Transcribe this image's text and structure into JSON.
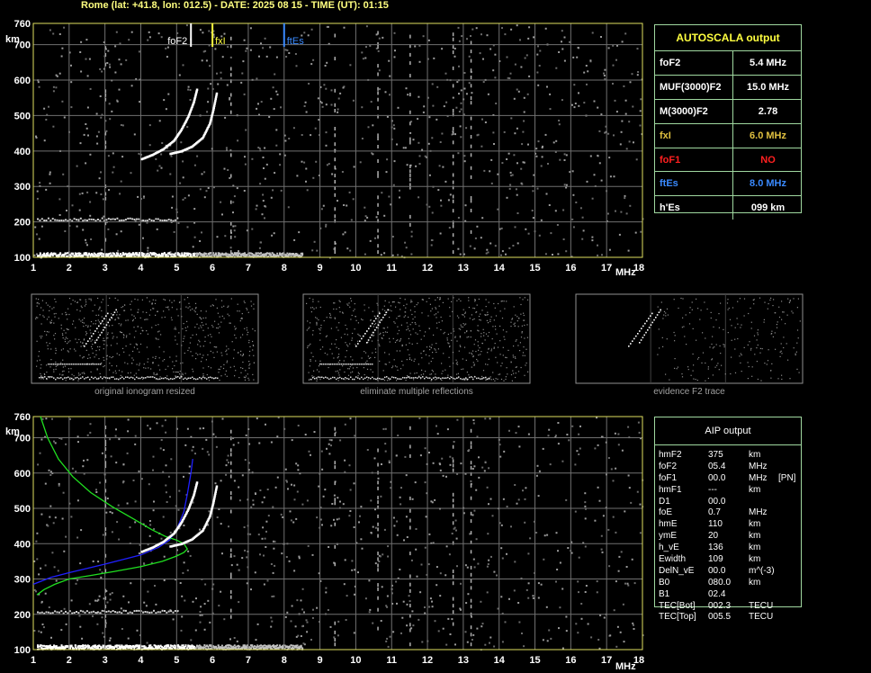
{
  "header": "Rome (lat: +41.8, lon: 012.5) - DATE: 2025 08 15 - TIME (UT): 01:15",
  "units": {
    "height": "km",
    "freq": "MHz"
  },
  "top_markers": [
    {
      "label": "foF2",
      "freq": 5.4,
      "color": "#ffffff"
    },
    {
      "label": "fxI",
      "freq": 6.0,
      "color": "#ffff40"
    },
    {
      "label": "ftEs",
      "freq": 8.0,
      "color": "#3a8aff"
    }
  ],
  "autoscala": {
    "title": "AUTOSCALA output",
    "rows": [
      {
        "label": "foF2",
        "value": "5.4  MHz",
        "color": "#ffffff"
      },
      {
        "label": "MUF(3000)F2",
        "value": "15.0 MHz",
        "color": "#ffffff"
      },
      {
        "label": "M(3000)F2",
        "value": "2.78",
        "color": "#ffffff"
      },
      {
        "label": "fxI",
        "value": "6.0  MHz",
        "color": "#e0c040"
      },
      {
        "label": "foF1",
        "value": "NO",
        "color": "#ff2020"
      },
      {
        "label": "ftEs",
        "value": "8.0  MHz",
        "color": "#3a8aff"
      },
      {
        "label": "h'Es",
        "value": "099     km",
        "color": "#ffffff"
      }
    ]
  },
  "thumbs": [
    {
      "caption": "original ionogram resized"
    },
    {
      "caption": "eliminate multiple reflections"
    },
    {
      "caption": "evidence F2 trace"
    }
  ],
  "aip": {
    "title": "AIP output",
    "rows": [
      {
        "name": "hmF2",
        "value": "375",
        "unit": "km",
        "extra": ""
      },
      {
        "name": "foF2",
        "value": "05.4",
        "unit": "MHz",
        "extra": ""
      },
      {
        "name": "foF1",
        "value": "00.0",
        "unit": "MHz",
        "extra": "[PN]"
      },
      {
        "name": "hmF1",
        "value": "---",
        "unit": "km",
        "extra": ""
      },
      {
        "name": "D1",
        "value": "00.0",
        "unit": "",
        "extra": ""
      },
      {
        "name": "foE",
        "value": "0.7",
        "unit": "MHz",
        "extra": ""
      },
      {
        "name": "hmE",
        "value": "110",
        "unit": "km",
        "extra": ""
      },
      {
        "name": "ymE",
        "value": "20",
        "unit": "km",
        "extra": ""
      },
      {
        "name": "h_vE",
        "value": "136",
        "unit": "km",
        "extra": ""
      },
      {
        "name": "Ewidth",
        "value": "109",
        "unit": "km",
        "extra": ""
      },
      {
        "name": "DelN_vE",
        "value": "00.0",
        "unit": "m^(-3)",
        "extra": ""
      },
      {
        "name": "B0",
        "value": "080.0",
        "unit": "km",
        "extra": ""
      },
      {
        "name": "B1",
        "value": "02.4",
        "unit": "",
        "extra": ""
      },
      {
        "name": "TEC[Bot]",
        "value": "002.3",
        "unit": "TECU",
        "extra": ""
      },
      {
        "name": "TEC[Top]",
        "value": "005.5",
        "unit": "TECU",
        "extra": ""
      }
    ]
  },
  "chart_data": [
    {
      "type": "scatter",
      "title": "",
      "xlabel": "MHz",
      "ylabel": "km",
      "xlim": [
        1,
        18
      ],
      "ylim": [
        100,
        760
      ],
      "x_ticks": [
        1,
        2,
        3,
        4,
        5,
        6,
        7,
        8,
        9,
        10,
        11,
        12,
        13,
        14,
        15,
        16,
        17,
        18
      ],
      "y_ticks": [
        100,
        200,
        300,
        400,
        500,
        600,
        700,
        760
      ],
      "grid": true,
      "series": [
        {
          "x": [
            4.0,
            4.3,
            4.6,
            4.9,
            5.1,
            5.3,
            5.45,
            5.55
          ],
          "y": [
            380,
            392,
            408,
            432,
            462,
            500,
            540,
            580
          ]
        },
        {
          "x": [
            4.8,
            5.1,
            5.4,
            5.7,
            5.9,
            6.0,
            6.1
          ],
          "y": [
            395,
            402,
            415,
            440,
            480,
            520,
            570
          ]
        }
      ]
    },
    {
      "type": "line",
      "title": "",
      "xlabel": "MHz",
      "ylabel": "km",
      "xlim": [
        1,
        18
      ],
      "ylim": [
        100,
        760
      ],
      "x_ticks": [
        1,
        2,
        3,
        4,
        5,
        6,
        7,
        8,
        9,
        10,
        11,
        12,
        13,
        14,
        15,
        16,
        17,
        18
      ],
      "y_ticks": [
        100,
        200,
        300,
        400,
        500,
        600,
        700,
        760
      ],
      "grid": true,
      "series": [
        {
          "color": "#2020ff",
          "x": [
            1.0,
            1.5,
            2.0,
            2.5,
            3.0,
            3.5,
            4.0,
            4.5,
            4.8,
            5.0,
            5.2,
            5.3,
            5.4,
            5.45
          ],
          "y": [
            285,
            305,
            318,
            330,
            342,
            355,
            368,
            390,
            410,
            440,
            490,
            540,
            600,
            640
          ]
        },
        {
          "color": "#20e020",
          "x": [
            1.2,
            1.4,
            1.7,
            2.1,
            2.6,
            3.2,
            3.8,
            4.3,
            4.7,
            5.0,
            5.2,
            5.3,
            5.2,
            5.0,
            4.6,
            4.0,
            3.3,
            2.6,
            2.0,
            1.6,
            1.3,
            1.1
          ],
          "y": [
            760,
            700,
            640,
            590,
            545,
            505,
            470,
            440,
            420,
            410,
            400,
            385,
            375,
            365,
            350,
            335,
            322,
            310,
            300,
            285,
            270,
            255
          ]
        }
      ]
    }
  ]
}
